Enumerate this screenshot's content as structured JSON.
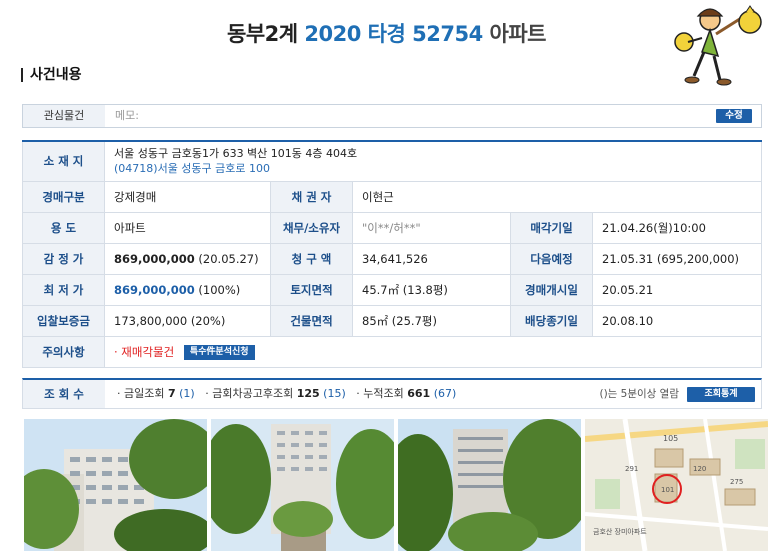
{
  "header": {
    "title_prefix": "동부2계",
    "case_number": "2020 타경 52754",
    "property_type": "아파트"
  },
  "section": {
    "title": "사건내용"
  },
  "memo": {
    "label": "관심물건",
    "placeholder": "메모:",
    "edit_button": "수정"
  },
  "details": {
    "location_label": "소 재 지",
    "address_line1": "서울 성동구 금호동1가 633 벽산 101동 4층 404호",
    "address_line2": "(04718)서울 성동구 금호로 100",
    "auction_type_label": "경매구분",
    "auction_type": "강제경매",
    "creditor_label": "채 권 자",
    "creditor": "이현근",
    "usage_label": "용 도",
    "usage": "아파트",
    "debtor_label": "채무/소유자",
    "debtor": "\"이**/허**\"",
    "sale_date_label": "매각기일",
    "sale_date": "21.04.26(월)10:00",
    "appraisal_label": "감 정 가",
    "appraisal_value": "869,000,000",
    "appraisal_date": "(20.05.27)",
    "claim_label": "청 구 액",
    "claim_value": "34,641,526",
    "next_label": "다음예정",
    "next_value": "21.05.31 (695,200,000)",
    "minimum_label": "최 저 가",
    "minimum_value": "869,000,000",
    "minimum_pct": "(100%)",
    "land_label": "토지면적",
    "land_value": "45.7㎡ (13.8평)",
    "start_label": "경매개시일",
    "start_value": "20.05.21",
    "deposit_label": "입찰보증금",
    "deposit_value": "173,800,000 (20%)",
    "building_label": "건물면적",
    "building_value": "85㎡ (25.7평)",
    "dividend_label": "배당종기일",
    "dividend_value": "20.08.10",
    "notes_label": "주의사항",
    "notes_value": "· 재매각물건",
    "notes_button": "특수件분석신청"
  },
  "views": {
    "label": "조 회 수",
    "today_label": "· 금일조회",
    "today_value": "7",
    "today_paren": "(1)",
    "after_label": "· 금회차공고후조회",
    "after_value": "125",
    "after_paren": "(15)",
    "total_label": "· 누적조회",
    "total_value": "661",
    "total_paren": "(67)",
    "note": "()는 5분이상 열람",
    "stats_button": "조회통계"
  },
  "photos": {
    "map_labels": [
      "105",
      "금호산 장미아파트",
      "291",
      "275",
      "120",
      "101"
    ]
  },
  "colors": {
    "accent": "#1d5fa8",
    "header_bg": "#eef2f7",
    "warning": "#e02020"
  }
}
